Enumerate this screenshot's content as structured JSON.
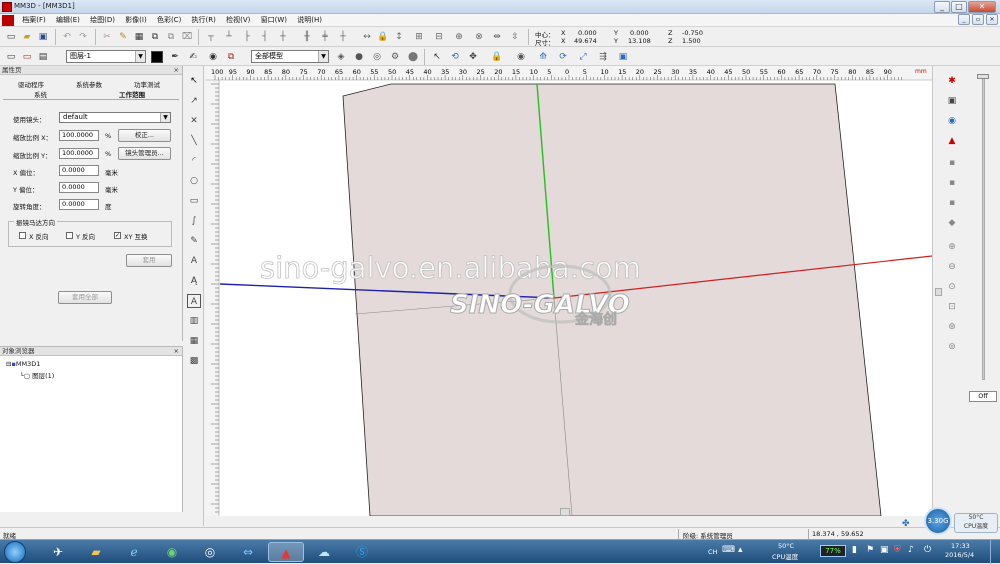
{
  "window": {
    "title": "MM3D - [MM3D1]",
    "controls": [
      "_",
      "□",
      "✕"
    ]
  },
  "menu": {
    "items": [
      "档案(F)",
      "编辑(E)",
      "绘图(D)",
      "影像(I)",
      "色彩(C)",
      "执行(R)",
      "检视(V)",
      "窗口(W)",
      "说明(H)"
    ]
  },
  "toolbar": {
    "center_label": "中心：",
    "size_label": "尺寸：",
    "center": {
      "x_label": "X",
      "x": "0.000",
      "y_label": "Y",
      "y": "0.000",
      "z_label": "Z",
      "z": "-0.750"
    },
    "size": {
      "x_label": "X",
      "x": "49.674",
      "y_label": "Y",
      "y": "13.108",
      "z_label": "Z",
      "z": "1.500"
    },
    "layer_select": "图层-1",
    "model_select": "全部模型"
  },
  "left_panel": {
    "header": "属性页",
    "tabs_row1": [
      "驱动程序",
      "系统参数",
      "功率测试"
    ],
    "tabs_row2": [
      "系统",
      "工作范围"
    ],
    "lens_label": "使用镜头：",
    "lens_value": "default",
    "scale_x_label": "缩放比例 X：",
    "scale_x_value": "100.0000",
    "scale_x_unit": "%",
    "calibrate_btn": "校正...",
    "scale_y_label": "缩放比例 Y：",
    "scale_y_value": "100.0000",
    "scale_y_unit": "%",
    "lens_manager_btn": "镜头管理员...",
    "offset_x_label": "X 偏位：",
    "offset_x_value": "0.0000",
    "offset_x_unit": "毫米",
    "offset_y_label": "Y 偏位：",
    "offset_y_value": "0.0000",
    "offset_y_unit": "毫米",
    "rotate_label": "旋转角度：",
    "rotate_value": "0.0000",
    "rotate_unit": "度",
    "group_label": "振镜马达方向",
    "chk_x": "X 反向",
    "chk_y": "Y 反向",
    "chk_xy": "XY 互换",
    "apply_btn": "套用",
    "apply_all_btn": "套用全部"
  },
  "browser": {
    "header": "对象浏览器",
    "root": "MM3D1",
    "child": "图层(1)"
  },
  "ruler": {
    "labels": [
      "100",
      "95",
      "90",
      "85",
      "80",
      "75",
      "70",
      "65",
      "60",
      "55",
      "50",
      "45",
      "40",
      "35",
      "30",
      "25",
      "20",
      "15",
      "10",
      "5",
      "0",
      "5",
      "10",
      "15",
      "20",
      "25",
      "30",
      "35",
      "40",
      "45",
      "50",
      "55",
      "60",
      "65",
      "70",
      "75",
      "80",
      "85",
      "90"
    ],
    "unit": "mm"
  },
  "canvas": {
    "watermark": "sino-galvo.en.alibaba.com",
    "logo_text": "SINO-GALVO",
    "logo_sub": "金海创"
  },
  "rightbar": {
    "off_label": "Off"
  },
  "status": {
    "ready": "就绪",
    "mode": "阶级: 系统管理员",
    "coords": "18.374 , 59.652"
  },
  "taskbar": {
    "temp": "50°C",
    "temp_label": "CPU温度",
    "battery": "77%",
    "time": "17:33",
    "date": "2016/5/4",
    "lang": "CH",
    "widget_value": "3.30",
    "widget_unit": "G",
    "widget_temp": "50°C",
    "widget_label": "CPU温度"
  },
  "colors": {
    "x_axis": "#2020b0",
    "y_axis": "#20c020",
    "z_axis": "#d02020",
    "slab": "#e3dad9"
  }
}
